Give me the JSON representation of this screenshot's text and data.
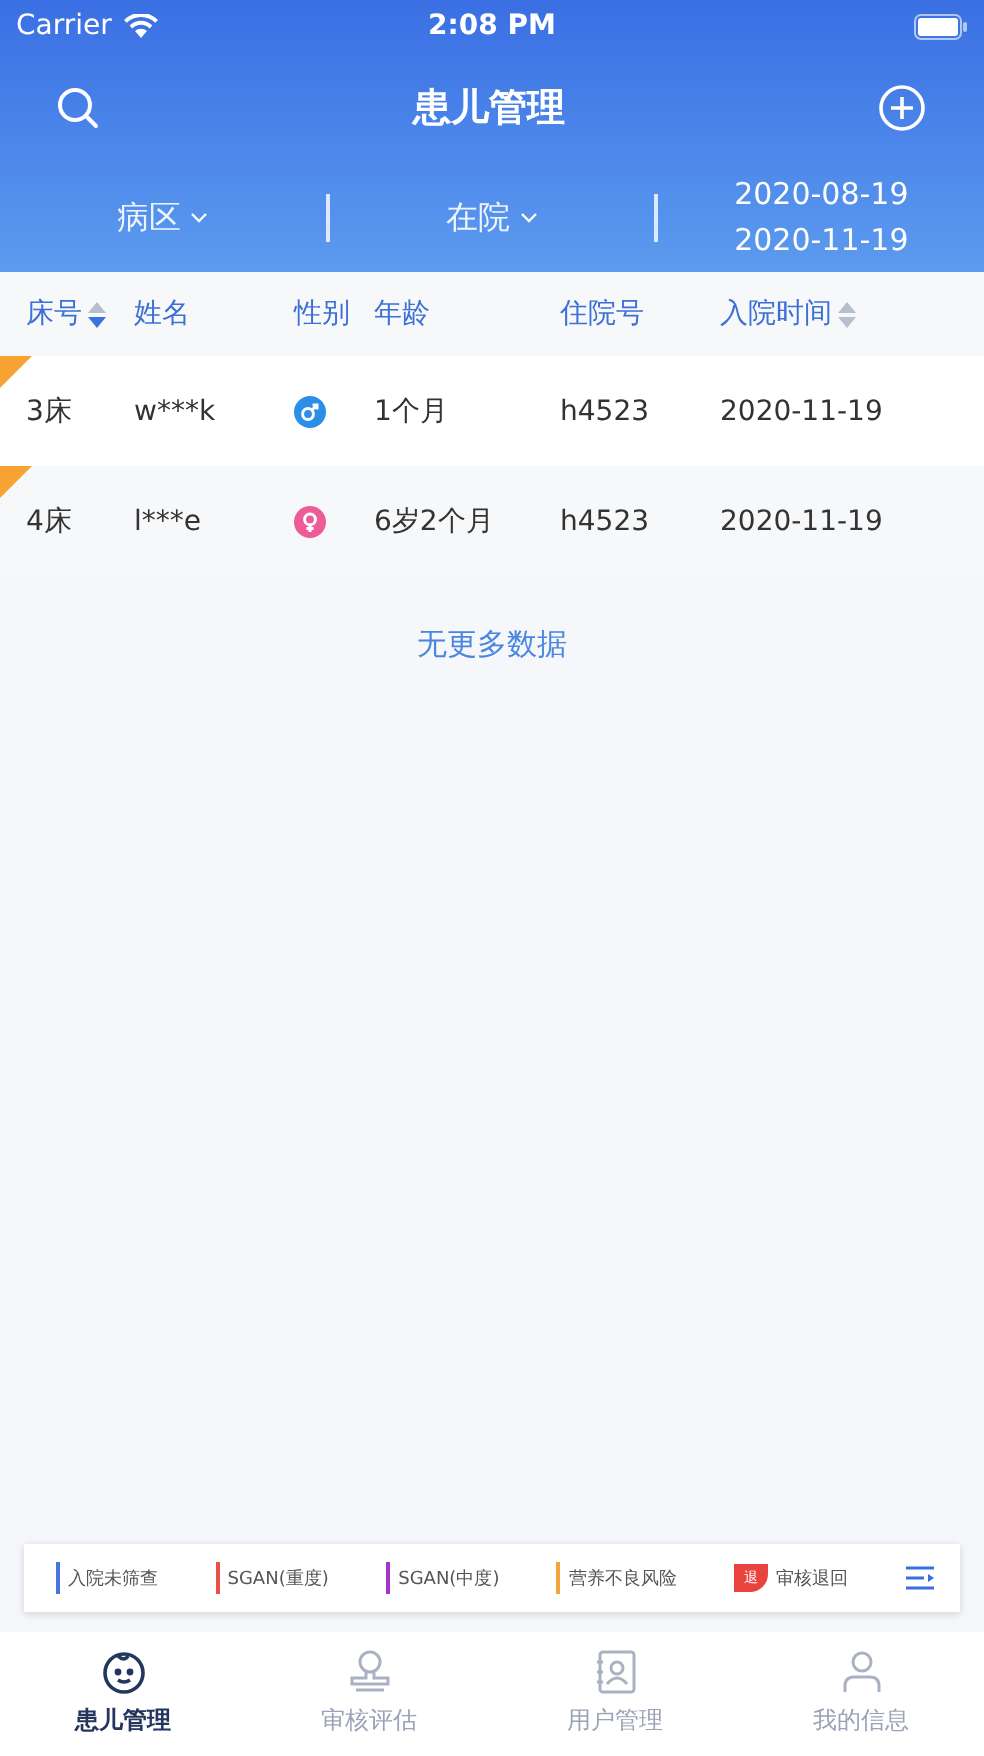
{
  "status_bar": {
    "carrier": "Carrier",
    "time": "2:08 PM"
  },
  "nav": {
    "title": "患儿管理"
  },
  "filters": [
    {
      "kind": "dropdown",
      "label": "病区"
    },
    {
      "kind": "dropdown",
      "label": "在院"
    },
    {
      "kind": "dates",
      "lines": [
        "2020-08-19",
        "2020-11-19"
      ]
    }
  ],
  "table": {
    "columns": [
      {
        "label": "床号",
        "kind": "sorted"
      },
      {
        "label": "姓名",
        "kind": "plain"
      },
      {
        "label": "性别",
        "kind": "plain"
      },
      {
        "label": "年龄",
        "kind": "plain"
      },
      {
        "label": "住院号",
        "kind": "plain"
      },
      {
        "label": "入院时间",
        "kind": "sortable"
      }
    ],
    "rows": [
      {
        "bed": "3床",
        "name": "w***k",
        "kind": "male",
        "age": "1个月",
        "admission_no": "h4523",
        "date": "2020-11-19",
        "color": "#f7a233"
      },
      {
        "bed": "4床",
        "name": "l***e",
        "kind": "female",
        "age": "6岁2个月",
        "admission_no": "h4523",
        "date": "2020-11-19",
        "color": "#f7a233"
      }
    ]
  },
  "footer_note": "无更多数据",
  "legend": [
    {
      "kind": "bar",
      "label": "入院未筛查",
      "color": "#4a74e0"
    },
    {
      "kind": "bar",
      "label": "SGAN(重度)",
      "color": "#e8514c"
    },
    {
      "kind": "bar",
      "label": "SGAN(中度)",
      "color": "#a634c9"
    },
    {
      "kind": "bar",
      "label": "营养不良风险",
      "color": "#f2a53a"
    },
    {
      "kind": "badge",
      "badge": "退",
      "label": "审核退回",
      "color": "#e8433f"
    }
  ],
  "tabbar": [
    {
      "label": "患儿管理",
      "selected": true
    },
    {
      "label": "审核评估",
      "selected": false
    },
    {
      "label": "用户管理",
      "selected": false
    },
    {
      "label": "我的信息",
      "selected": false
    }
  ]
}
